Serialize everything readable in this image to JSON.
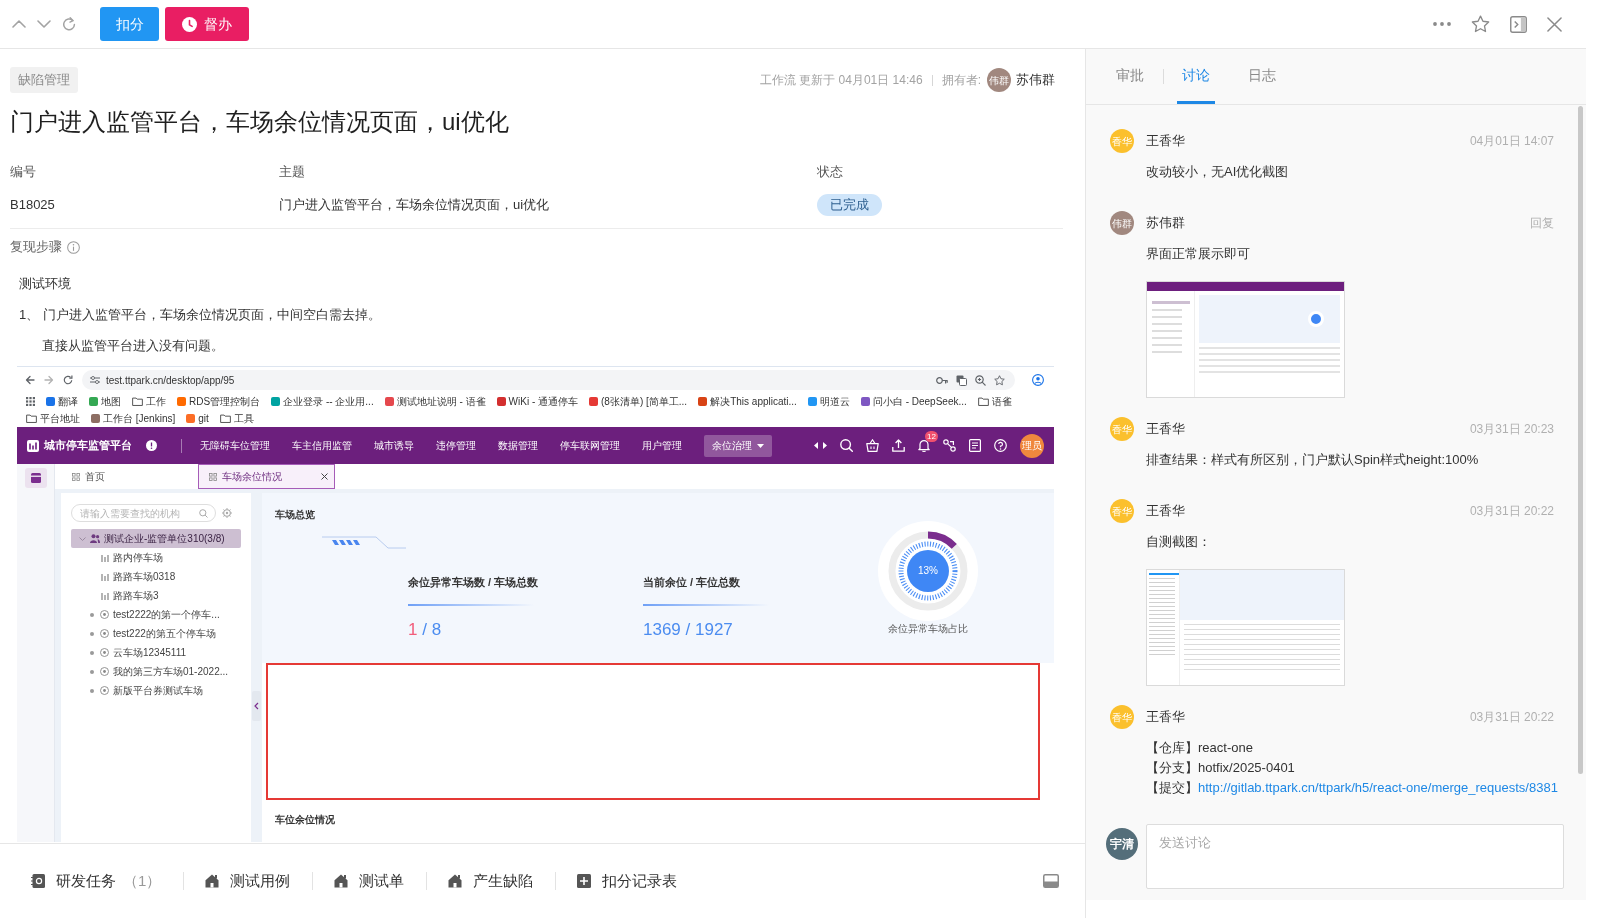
{
  "toolbar": {
    "buttons": [
      {
        "label": "扣分",
        "kind": "primary"
      },
      {
        "label": "督办",
        "kind": "urgent"
      }
    ]
  },
  "header": {
    "category": "缺陷管理",
    "workflow_info": "工作流 更新于 04月01日 14:46",
    "owner_label": "拥有者:",
    "owner": {
      "avatar": "伟群",
      "name": "苏伟群",
      "color": "#a1887f"
    }
  },
  "title": "门户进入监管平台，车场余位情况页面，ui优化",
  "fields": [
    {
      "label": "编号",
      "value": "B18025",
      "kind": "text"
    },
    {
      "label": "主题",
      "value": "门户进入监管平台，车场余位情况页面，ui优化",
      "kind": "text"
    },
    {
      "label": "状态",
      "value": "已完成",
      "kind": "badge"
    }
  ],
  "steps": {
    "title": "复现步骤",
    "lines": [
      {
        "kind": "plain",
        "text": "测试环境"
      },
      {
        "kind": "numbered",
        "number": "1、",
        "text": "门户进入监管平台，车场余位情况页面，中间空白需去掉。"
      },
      {
        "kind": "indented",
        "text": "直接从监管平台进入没有问题。"
      }
    ]
  },
  "screenshot": {
    "url": "test.ttpark.cn/desktop/app/95",
    "bookmarks": [
      {
        "label": "翻译",
        "kind": "site",
        "color": "#1a73e8"
      },
      {
        "label": "地图",
        "kind": "site",
        "color": "#34a853"
      },
      {
        "label": "工作",
        "kind": "folder"
      },
      {
        "label": "RDS管理控制台",
        "kind": "site",
        "color": "#ff6a00"
      },
      {
        "label": "企业登录 -- 企业用...",
        "kind": "site",
        "color": "#00a3a1"
      },
      {
        "label": "测试地址说明 - 语雀",
        "kind": "site",
        "color": "#e5484d"
      },
      {
        "label": "WiKi - 通通停车",
        "kind": "site",
        "color": "#d32f2f"
      },
      {
        "label": "(8张清单) [简单工...",
        "kind": "site",
        "color": "#e53935"
      },
      {
        "label": "解决This applicati...",
        "kind": "site",
        "color": "#d84315"
      },
      {
        "label": "明道云",
        "kind": "site",
        "color": "#2196f3"
      },
      {
        "label": "问小白 - DeepSeek...",
        "kind": "site",
        "color": "#7e57c2"
      },
      {
        "label": "语雀",
        "kind": "folder"
      },
      {
        "label": "平台地址",
        "kind": "folder"
      },
      {
        "label": "工作台 [Jenkins]",
        "kind": "site",
        "color": "#8d6e63"
      },
      {
        "label": "git",
        "kind": "site",
        "color": "#fc6d26"
      },
      {
        "label": "工具",
        "kind": "folder"
      }
    ],
    "app_title": "城市停车监管平台",
    "menu": [
      {
        "label": "无障碍车位管理",
        "selected": false
      },
      {
        "label": "车主信用监管",
        "selected": false
      },
      {
        "label": "城市诱导",
        "selected": false
      },
      {
        "label": "违停管理",
        "selected": false
      },
      {
        "label": "数据管理",
        "selected": false
      },
      {
        "label": "停车联网管理",
        "selected": false
      },
      {
        "label": "用户管理",
        "selected": false
      },
      {
        "label": "余位治理",
        "selected": true
      }
    ],
    "notification_count": "12",
    "user_avatar": "理员",
    "tabs": [
      {
        "label": "首页",
        "selected": false
      },
      {
        "label": "车场余位情况",
        "selected": true
      }
    ],
    "tree_search": {
      "placeholder": "请输入需要查找的机构"
    },
    "tree": [
      {
        "label": "测试企业-监管单位310(3/8)",
        "kind": "org",
        "selected": true,
        "expanded": true,
        "children": [
          {
            "label": "路内停车场",
            "kind": "lot",
            "selected": false
          },
          {
            "label": "路路车场0318",
            "kind": "lot",
            "selected": false
          },
          {
            "label": "路路车场3",
            "kind": "lot",
            "selected": false
          }
        ]
      },
      {
        "label": "test2222的第一个停车...",
        "kind": "parking",
        "selected": false
      },
      {
        "label": "test222的第五个停车场",
        "kind": "parking",
        "selected": false
      },
      {
        "label": "云车场12345111",
        "kind": "parking",
        "selected": false
      },
      {
        "label": "我的第三方车场01-2022...",
        "kind": "parking",
        "selected": false
      },
      {
        "label": "新版平台券测试车场",
        "kind": "parking",
        "selected": false
      }
    ],
    "overview": {
      "title": "车场总览",
      "stats": [
        {
          "label": "余位异常车场数 / 车场总数",
          "alert": "1",
          "value": "/ 8"
        },
        {
          "label": "当前余位 / 车位总数",
          "value": "1369 / 1927"
        }
      ],
      "gauge": {
        "level": 0.13,
        "reading": "13%",
        "caption": "余位异常车场占比"
      }
    },
    "detail_title": "车位余位情况"
  },
  "bottom_tabs": [
    {
      "label": "研发任务",
      "count": "（1）",
      "kind": "task"
    },
    {
      "label": "测试用例",
      "kind": "module"
    },
    {
      "label": "测试单",
      "kind": "module"
    },
    {
      "label": "产生缺陷",
      "kind": "module"
    },
    {
      "label": "扣分记录表",
      "kind": "table"
    }
  ],
  "discussion": {
    "tabs": [
      {
        "label": "审批",
        "selected": false
      },
      {
        "label": "讨论",
        "selected": true
      },
      {
        "label": "日志",
        "selected": false
      }
    ],
    "comments": [
      {
        "author": "王香华",
        "avatar": "香华",
        "color": "#fbc02d",
        "time": "04月01日 14:07",
        "body": [
          {
            "kind": "text",
            "text": "改动较小，无AI优化截图"
          }
        ]
      },
      {
        "author": "苏伟群",
        "avatar": "伟群",
        "color": "#a1887f",
        "reply": "回复",
        "body": [
          {
            "kind": "text",
            "text": "界面正常展示即可"
          },
          {
            "kind": "image"
          }
        ]
      },
      {
        "author": "王香华",
        "avatar": "香华",
        "color": "#fbc02d",
        "time": "03月31日 20:23",
        "body": [
          {
            "kind": "text",
            "text": "排查结果：样式有所区别，门户默认Spin样式height:100%"
          }
        ]
      },
      {
        "author": "王香华",
        "avatar": "香华",
        "color": "#fbc02d",
        "time": "03月31日 20:22",
        "body": [
          {
            "kind": "text",
            "text": "自测截图："
          },
          {
            "kind": "image"
          }
        ]
      },
      {
        "author": "王香华",
        "avatar": "香华",
        "color": "#fbc02d",
        "time": "03月31日 20:22",
        "body": [
          {
            "kind": "text",
            "text": "【仓库】react-one"
          },
          {
            "kind": "text",
            "text": "【分支】hotfix/2025-0401"
          },
          {
            "kind": "link",
            "label": "【提交】",
            "url": "http://gitlab.ttpark.cn/ttpark/h5/react-one/merge_requests/8381"
          }
        ]
      }
    ],
    "composer": {
      "avatar": "宇清",
      "color": "#546e7a",
      "placeholder": "发送讨论"
    }
  }
}
